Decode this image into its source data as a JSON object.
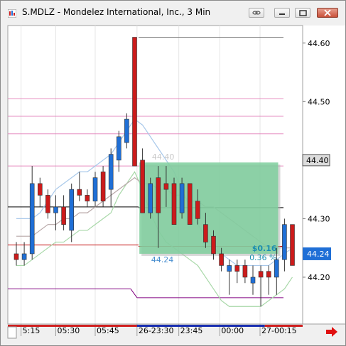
{
  "window": {
    "title": "S.MDLZ - Mondelez International, Inc., 3 Min",
    "controls": [
      "link-icon",
      "minimize-icon",
      "restore-icon",
      "close-icon"
    ]
  },
  "chart_data": {
    "type": "candlestick",
    "symbol": "S.MDLZ",
    "interval": "3 Min",
    "ylim": [
      44.12,
      44.63
    ],
    "y_ticks": [
      44.6,
      44.5,
      44.4,
      44.3,
      44.2
    ],
    "y_tick_labels": [
      "44.60",
      "44.50",
      "44.40",
      "44.30",
      "44.20"
    ],
    "x_tick_labels": [
      "5:15",
      "05:30",
      "05:45",
      "26-23:30",
      "23:45",
      "00:00",
      "27-00:15"
    ],
    "last_price_label": "44.24",
    "cursor_price_label": "44.40",
    "candles": [
      {
        "o": 44.24,
        "h": 44.26,
        "l": 44.22,
        "c": 44.23
      },
      {
        "o": 44.23,
        "h": 44.26,
        "l": 44.22,
        "c": 44.24
      },
      {
        "o": 44.24,
        "h": 44.39,
        "l": 44.23,
        "c": 44.36
      },
      {
        "o": 44.36,
        "h": 44.37,
        "l": 44.32,
        "c": 44.34
      },
      {
        "o": 44.34,
        "h": 44.35,
        "l": 44.3,
        "c": 44.31
      },
      {
        "o": 44.31,
        "h": 44.34,
        "l": 44.28,
        "c": 44.32
      },
      {
        "o": 44.32,
        "h": 44.34,
        "l": 44.28,
        "c": 44.29
      },
      {
        "o": 44.28,
        "h": 44.36,
        "l": 44.26,
        "c": 44.35
      },
      {
        "o": 44.35,
        "h": 44.38,
        "l": 44.33,
        "c": 44.34
      },
      {
        "o": 44.34,
        "h": 44.35,
        "l": 44.32,
        "c": 44.33
      },
      {
        "o": 44.33,
        "h": 44.38,
        "l": 44.32,
        "c": 44.37
      },
      {
        "o": 44.38,
        "h": 44.39,
        "l": 44.32,
        "c": 44.33
      },
      {
        "o": 44.35,
        "h": 44.42,
        "l": 44.32,
        "c": 44.41
      },
      {
        "o": 44.4,
        "h": 44.45,
        "l": 44.38,
        "c": 44.44
      },
      {
        "o": 44.43,
        "h": 44.48,
        "l": 44.42,
        "c": 44.47
      },
      {
        "o": 44.61,
        "h": 44.61,
        "l": 44.39,
        "c": 44.39
      },
      {
        "o": 44.4,
        "h": 44.42,
        "l": 44.31,
        "c": 44.31
      },
      {
        "o": 44.31,
        "h": 44.37,
        "l": 44.3,
        "c": 44.36
      },
      {
        "o": 44.37,
        "h": 44.39,
        "l": 44.25,
        "c": 44.31
      },
      {
        "o": 44.36,
        "h": 44.39,
        "l": 44.32,
        "c": 44.35
      },
      {
        "o": 44.36,
        "h": 44.37,
        "l": 44.29,
        "c": 44.29
      },
      {
        "o": 44.31,
        "h": 44.37,
        "l": 44.3,
        "c": 44.36
      },
      {
        "o": 44.36,
        "h": 44.36,
        "l": 44.29,
        "c": 44.29
      },
      {
        "o": 44.33,
        "h": 44.35,
        "l": 44.29,
        "c": 44.3
      },
      {
        "o": 44.29,
        "h": 44.31,
        "l": 44.25,
        "c": 44.26
      },
      {
        "o": 44.27,
        "h": 44.28,
        "l": 44.23,
        "c": 44.24
      },
      {
        "o": 44.24,
        "h": 44.25,
        "l": 44.21,
        "c": 44.22
      },
      {
        "o": 44.21,
        "h": 44.23,
        "l": 44.17,
        "c": 44.22
      },
      {
        "o": 44.22,
        "h": 44.23,
        "l": 44.19,
        "c": 44.21
      },
      {
        "o": 44.22,
        "h": 44.23,
        "l": 44.19,
        "c": 44.2
      },
      {
        "o": 44.19,
        "h": 44.22,
        "l": 44.17,
        "c": 44.2
      },
      {
        "o": 44.21,
        "h": 44.22,
        "l": 44.15,
        "c": 44.2
      },
      {
        "o": 44.21,
        "h": 44.22,
        "l": 44.17,
        "c": 44.2
      },
      {
        "o": 44.2,
        "h": 44.25,
        "l": 44.17,
        "c": 44.23
      },
      {
        "o": 44.23,
        "h": 44.3,
        "l": 44.21,
        "c": 44.29
      },
      {
        "o": 44.29,
        "h": 44.29,
        "l": 44.22,
        "c": 44.22
      }
    ],
    "horizontal_lines": [
      {
        "price": 44.61,
        "color": "#777777"
      },
      {
        "price": 44.505,
        "color": "#e070b0"
      },
      {
        "price": 44.475,
        "color": "#e070b0"
      },
      {
        "price": 44.445,
        "color": "#e070b0"
      },
      {
        "price": 44.39,
        "color": "#e070b0"
      },
      {
        "price": 44.32,
        "color": "#000000"
      },
      {
        "price": 44.255,
        "color": "#c00000"
      },
      {
        "price": 44.165,
        "color": "#800080"
      }
    ],
    "bands": {
      "blue_upper": [
        44.3,
        44.3,
        44.3,
        44.31,
        44.33,
        44.35,
        44.36,
        44.37,
        44.38,
        44.38,
        44.39,
        44.4,
        44.41,
        44.43,
        44.45,
        44.47,
        44.46,
        44.44,
        44.42,
        44.4,
        44.38,
        44.35,
        44.32,
        44.29,
        44.27,
        44.25,
        44.24,
        44.23,
        44.22,
        44.22,
        44.22,
        44.22,
        44.22,
        44.23,
        44.24,
        44.25
      ],
      "gray_mid": [
        44.27,
        44.27,
        44.27,
        44.28,
        44.29,
        44.29,
        44.3,
        44.3,
        44.31,
        44.31,
        44.32,
        44.33,
        44.34,
        44.35,
        44.36,
        44.37,
        44.36,
        44.36,
        44.35,
        44.35,
        44.34,
        44.34,
        44.33,
        44.33,
        44.32,
        44.32,
        44.31,
        44.3,
        44.29,
        44.28,
        44.27,
        44.26,
        44.25,
        44.25,
        44.25,
        44.25
      ],
      "green_lower": [
        44.22,
        44.22,
        44.23,
        44.24,
        44.25,
        44.26,
        44.26,
        44.27,
        44.28,
        44.28,
        44.29,
        44.3,
        44.31,
        44.34,
        44.36,
        44.38,
        44.35,
        44.31,
        44.28,
        44.26,
        44.25,
        44.24,
        44.23,
        44.22,
        44.2,
        44.18,
        44.16,
        44.15,
        44.15,
        44.15,
        44.15,
        44.15,
        44.16,
        44.17,
        44.18,
        44.2
      ]
    },
    "measure_box": {
      "price_top": 44.396,
      "price_bottom": 44.24,
      "start_label": "44.40",
      "end_label": "44.24",
      "value_label": "$0.16",
      "pct_label": "0.36 %"
    },
    "colors": {
      "up": "#1f6fd6",
      "down": "#cc1b1b",
      "measure_fill": "#7fcf9e",
      "measure_text": "#4a8fd0",
      "value_text": "#1c8fb0",
      "last_price_bg": "#1f6fd6"
    }
  }
}
